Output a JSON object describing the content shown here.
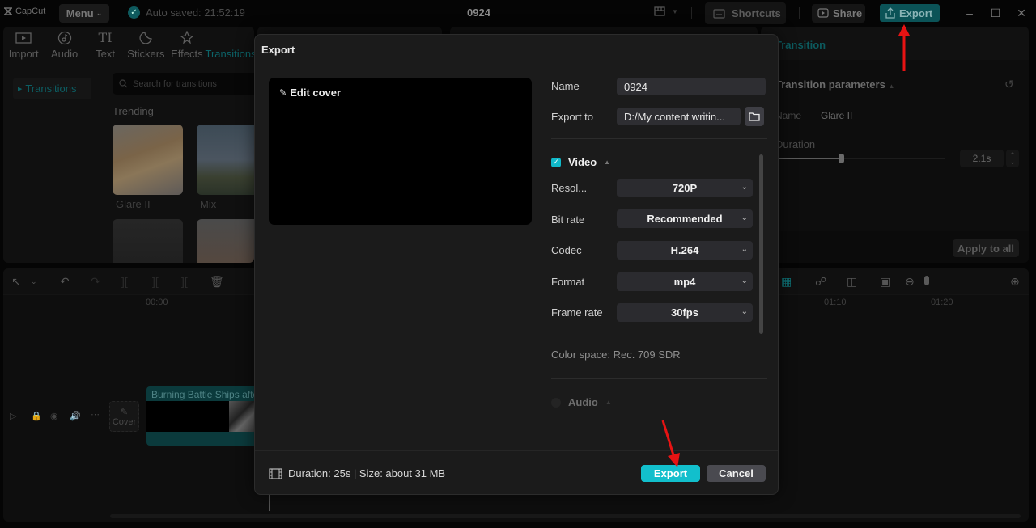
{
  "app": {
    "logo_text": "CapCut",
    "menu_label": "Menu",
    "autosave_text": "Auto saved: 21:52:19",
    "project_title": "0924",
    "shortcuts_label": "Shortcuts",
    "share_label": "Share",
    "export_label": "Export"
  },
  "media_panel": {
    "tools": [
      {
        "label": "Import",
        "icon": "import-icon"
      },
      {
        "label": "Audio",
        "icon": "audio-icon"
      },
      {
        "label": "Text",
        "icon": "text-icon"
      },
      {
        "label": "Stickers",
        "icon": "stickers-icon"
      },
      {
        "label": "Effects",
        "icon": "effects-icon"
      },
      {
        "label": "Transitions",
        "icon": "transitions-icon",
        "active": true
      }
    ],
    "category": "Transitions",
    "search_placeholder": "Search for transitions",
    "section_title": "Trending",
    "items": [
      {
        "label": "Glare II"
      },
      {
        "label": "Mix"
      }
    ]
  },
  "properties_panel": {
    "tab": "Transition",
    "section_title": "Transition parameters",
    "name_label": "Name",
    "name_value": "Glare II",
    "duration_label": "Duration",
    "duration_value": "2.1s",
    "duration_fraction": 0.38,
    "apply_all_label": "Apply to all"
  },
  "timeline": {
    "ruler": [
      "00:00",
      "01:10",
      "01:20"
    ],
    "cover_label": "Cover",
    "clip_title": "Burning Battle Ships after"
  },
  "export_dialog": {
    "title": "Export",
    "edit_cover_label": "Edit cover",
    "name_label": "Name",
    "name_value": "0924",
    "export_to_label": "Export to",
    "export_to_value": "D:/My content writin...",
    "video_section": {
      "label": "Video",
      "checked": true,
      "fields": [
        {
          "label": "Resol...",
          "value": "720P"
        },
        {
          "label": "Bit rate",
          "value": "Recommended"
        },
        {
          "label": "Codec",
          "value": "H.264"
        },
        {
          "label": "Format",
          "value": "mp4"
        },
        {
          "label": "Frame rate",
          "value": "30fps"
        }
      ],
      "color_space": "Color space: Rec. 709 SDR"
    },
    "audio_section": {
      "label": "Audio",
      "checked": false
    },
    "summary": "Duration: 25s | Size: about 31 MB",
    "export_button": "Export",
    "cancel_button": "Cancel"
  },
  "colors": {
    "accent": "#12bfcc",
    "annotation_arrow": "#e81313"
  }
}
